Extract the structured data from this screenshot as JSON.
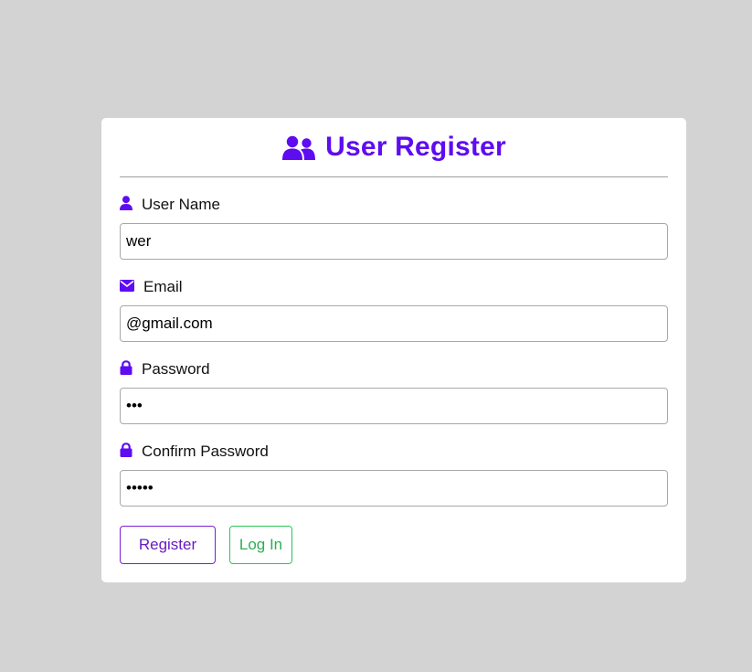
{
  "form": {
    "title": "User Register",
    "title_icon": "users-icon",
    "accent_color": "#5e0cf0",
    "fields": [
      {
        "label": "User Name",
        "icon": "user-icon",
        "value": "wer",
        "type": "text"
      },
      {
        "label": "Email",
        "icon": "envelope-icon",
        "value": "@gmail.com",
        "type": "email"
      },
      {
        "label": "Password",
        "icon": "lock-icon",
        "value": "abc",
        "type": "password"
      },
      {
        "label": "Confirm Password",
        "icon": "lock-icon",
        "value": "abcde",
        "type": "password"
      }
    ],
    "buttons": {
      "register_label": "Register",
      "register_color": "#7a1fd1",
      "login_label": "Log In",
      "login_color": "#2ec45a"
    }
  }
}
